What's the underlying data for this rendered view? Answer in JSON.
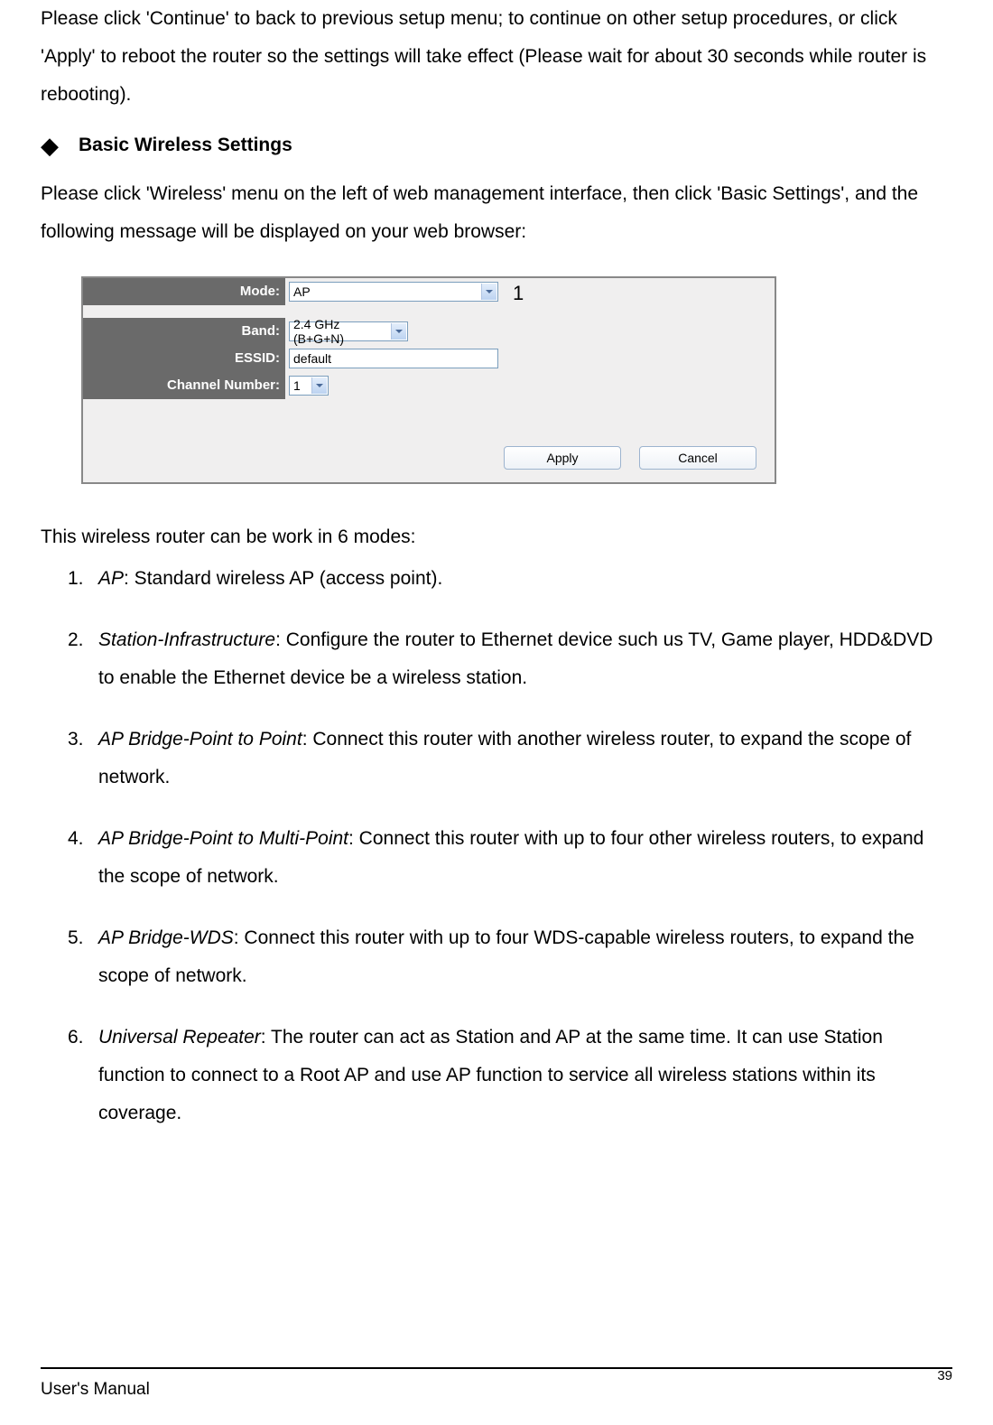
{
  "intro_para": "Please click 'Continue' to back to previous setup menu; to continue on other setup procedures, or click 'Apply' to reboot the router so the settings will take effect (Please wait for about 30 seconds while router is rebooting).",
  "section": {
    "bullet": "◆",
    "title": "Basic Wireless Settings"
  },
  "para2": "Please click 'Wireless' menu on the left of web management interface, then click 'Basic Settings', and the following message will be displayed on your web browser:",
  "form": {
    "mode_label": "Mode:",
    "mode_value": "AP",
    "band_label": "Band:",
    "band_value": "2.4 GHz (B+G+N)",
    "essid_label": "ESSID:",
    "essid_value": "default",
    "channel_label": "Channel Number:",
    "channel_value": "1",
    "apply_button": "Apply",
    "cancel_button": "Cancel",
    "callout": "1"
  },
  "list_intro": "This wireless router can be work in 6 modes:",
  "modes": [
    {
      "num": "1.",
      "name": "AP",
      "desc": ": Standard wireless AP (access point)."
    },
    {
      "num": "2.",
      "name": "Station-Infrastructure",
      "desc": ": Configure the router to Ethernet device such us TV, Game player, HDD&DVD to enable the Ethernet device be a wireless station."
    },
    {
      "num": "3.",
      "name": "AP Bridge-Point to Point",
      "desc": ": Connect this router with another wireless router, to expand the scope of network."
    },
    {
      "num": "4.",
      "name": "AP Bridge-Point to Multi-Point",
      "desc": ": Connect this router with up to four other wireless routers, to expand the scope of network."
    },
    {
      "num": "5.",
      "name": "AP Bridge-WDS",
      "desc": ": Connect this router with up to four WDS-capable wireless routers, to expand the scope of network."
    },
    {
      "num": "6.",
      "name": "Universal Repeater",
      "desc": ": The router can act as Station and AP at the same time. It can use Station function to connect to a Root AP and use AP function to service all wireless stations within its coverage."
    }
  ],
  "footer": {
    "text": "User's Manual",
    "page": "39"
  }
}
